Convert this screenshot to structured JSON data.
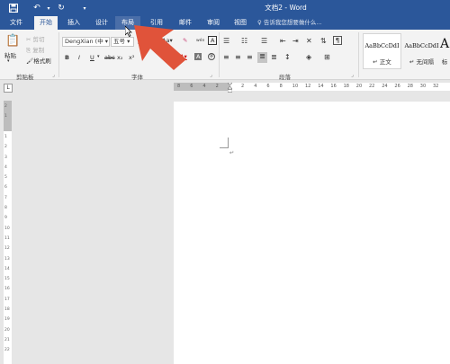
{
  "window": {
    "title": "文档2 - Word",
    "qat": {
      "save_icon": "save-icon",
      "undo_icon": "undo-icon",
      "redo_icon": "redo-icon",
      "customize_icon": "customize-qat-icon"
    }
  },
  "tabs": [
    {
      "label": "文件"
    },
    {
      "label": "开始"
    },
    {
      "label": "插入"
    },
    {
      "label": "设计"
    },
    {
      "label": "布局"
    },
    {
      "label": "引用"
    },
    {
      "label": "邮件"
    },
    {
      "label": "审阅"
    },
    {
      "label": "视图"
    }
  ],
  "tellme": "♀ 告诉我您想要做什么...",
  "clipboard": {
    "paste": "粘贴",
    "cut": "剪切",
    "copy": "复制",
    "format_painter": "格式刷",
    "group_label": "剪贴板"
  },
  "font": {
    "name": "DengXian (中",
    "size": "五号",
    "group_label": "字体",
    "bold": "B",
    "italic": "I",
    "underline": "U",
    "strike": "abc",
    "subscript": "x₂",
    "superscript": "x²",
    "change_case": "Aa",
    "font_color": "A",
    "char_border": "A",
    "phonetic": "wén"
  },
  "paragraph": {
    "group_label": "段落"
  },
  "styles": [
    {
      "sample": "AaBbCcDdI",
      "name": "↵ 正文"
    },
    {
      "sample": "AaBbCcDdI",
      "name": "↵ 无间隔"
    },
    {
      "sample": "A",
      "name": "标"
    }
  ],
  "ruler": {
    "tab_selector": "L",
    "h_numbers": [
      "8",
      "6",
      "4",
      "2",
      "",
      "2",
      "4",
      "6",
      "8",
      "10",
      "12",
      "14",
      "16",
      "18",
      "20",
      "22",
      "24",
      "26",
      "28",
      "30",
      "32"
    ],
    "v_numbers": [
      "2",
      "1",
      "",
      "1",
      "2",
      "3",
      "4",
      "5",
      "6",
      "7",
      "8",
      "9",
      "10",
      "11",
      "12",
      "13",
      "14",
      "15",
      "16",
      "17",
      "18",
      "19",
      "20",
      "21",
      "22"
    ]
  },
  "document": {
    "para_mark": "↵"
  },
  "colors": {
    "brand": "#2b579a",
    "arrow": "#e0533a"
  }
}
